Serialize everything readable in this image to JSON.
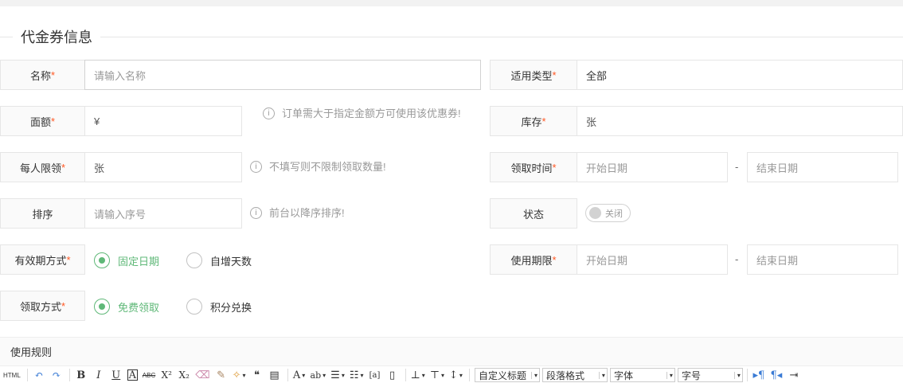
{
  "section_title": "代金券信息",
  "required_mark": "*",
  "fields": {
    "name": {
      "label": "名称",
      "placeholder": "请输入名称"
    },
    "applicable_type": {
      "label": "适用类型",
      "value": "全部"
    },
    "face_value": {
      "label": "面额",
      "prefix": "¥",
      "tip": "订单需大于指定金额方可使用该优惠券!"
    },
    "stock": {
      "label": "库存",
      "unit": "张"
    },
    "per_person_limit": {
      "label": "每人限领",
      "unit": "张",
      "tip": "不填写则不限制领取数量!"
    },
    "claim_time": {
      "label": "领取时间",
      "start_placeholder": "开始日期",
      "separator": "-",
      "end_placeholder": "结束日期"
    },
    "sort": {
      "label": "排序",
      "placeholder": "请输入序号",
      "tip": "前台以降序排序!"
    },
    "status": {
      "label": "状态",
      "switch_text": "关闭"
    },
    "validity_mode": {
      "label": "有效期方式",
      "options": [
        "固定日期",
        "自增天数"
      ],
      "selected": "固定日期"
    },
    "use_period": {
      "label": "使用期限",
      "start_placeholder": "开始日期",
      "separator": "-",
      "end_placeholder": "结束日期"
    },
    "claim_method": {
      "label": "领取方式",
      "options": [
        "免费领取",
        "积分兑换"
      ],
      "selected": "免费领取"
    }
  },
  "rules": {
    "label": "使用规则",
    "toolbar": {
      "html_label": "HTML",
      "bold": "B",
      "italic": "I",
      "underline": "U",
      "border": "A",
      "strike": "ABC",
      "superscript": "X²",
      "subscript": "X₂",
      "font_color": "A",
      "highlight": "ab",
      "quote": "❝",
      "custom_heading": "自定义标题",
      "paragraph_format": "段落格式",
      "font_family": "字体",
      "font_size": "字号"
    }
  },
  "colors": {
    "accent": "#5fb878",
    "required": "#ff5722",
    "border": "#e6e6e6",
    "label_bg": "#fafafa"
  }
}
